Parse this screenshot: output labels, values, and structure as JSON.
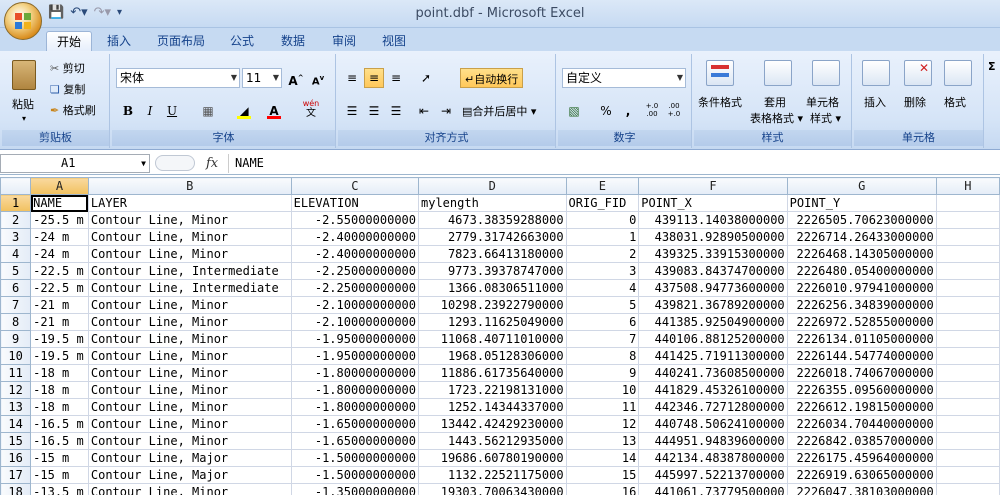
{
  "window": {
    "title": "point.dbf - Microsoft Excel"
  },
  "ribbon": {
    "tabs": [
      "开始",
      "插入",
      "页面布局",
      "公式",
      "数据",
      "审阅",
      "视图"
    ],
    "clipboard": {
      "paste": "粘贴",
      "cut": "剪切",
      "copy": "复制",
      "format_painter": "格式刷",
      "label": "剪贴板"
    },
    "font": {
      "name": "宋体",
      "size": "11",
      "label": "字体",
      "bold": "B",
      "italic": "I",
      "underline": "U",
      "grow": "A",
      "shrink": "A",
      "fill_color": "#ffff00",
      "font_color": "#ff0000",
      "wen": "wén\n文"
    },
    "alignment": {
      "wrap": "自动换行",
      "merge": "合并后居中",
      "label": "对齐方式"
    },
    "number": {
      "format": "自定义",
      "percent": "%",
      "comma": ",",
      "inc": "+.0\n.00",
      "dec": ".00\n+.0",
      "label": "数字"
    },
    "styles": {
      "conditional": "条件格式",
      "table_line1": "套用",
      "table_line2": "表格格式",
      "cell_line1": "单元格",
      "cell_line2": "样式",
      "label": "样式"
    },
    "cells": {
      "insert": "插入",
      "delete": "删除",
      "format": "格式",
      "label": "单元格"
    },
    "editing": {
      "sigma": "Σ"
    }
  },
  "formula_bar": {
    "name_box": "A1",
    "fx": "fx",
    "content": "NAME"
  },
  "sheet": {
    "columns": [
      "A",
      "B",
      "C",
      "D",
      "E",
      "F",
      "G",
      "H"
    ],
    "rows": [
      {
        "n": "1",
        "cells": [
          "NAME",
          "LAYER",
          "ELEVATION",
          "mylength",
          "ORIG_FID",
          "POINT_X",
          "POINT_Y"
        ]
      },
      {
        "n": "2",
        "cells": [
          "-25.5 m",
          "Contour Line, Minor",
          "-2.55000000000",
          "4673.38359288000",
          "0",
          "439113.14038000000",
          "2226505.70623000000"
        ]
      },
      {
        "n": "3",
        "cells": [
          "-24 m",
          "Contour Line, Minor",
          "-2.40000000000",
          "2779.31742663000",
          "1",
          "438031.92890500000",
          "2226714.26433000000"
        ]
      },
      {
        "n": "4",
        "cells": [
          "-24 m",
          "Contour Line, Minor",
          "-2.40000000000",
          "7823.66413180000",
          "2",
          "439325.33915300000",
          "2226468.14305000000"
        ]
      },
      {
        "n": "5",
        "cells": [
          "-22.5 m",
          "Contour Line, Intermediate",
          "-2.25000000000",
          "9773.39378747000",
          "3",
          "439083.84374700000",
          "2226480.05400000000"
        ]
      },
      {
        "n": "6",
        "cells": [
          "-22.5 m",
          "Contour Line, Intermediate",
          "-2.25000000000",
          "1366.08306511000",
          "4",
          "437508.94773600000",
          "2226010.97941000000"
        ]
      },
      {
        "n": "7",
        "cells": [
          "-21 m",
          "Contour Line, Minor",
          "-2.10000000000",
          "10298.23922790000",
          "5",
          "439821.36789200000",
          "2226256.34839000000"
        ]
      },
      {
        "n": "8",
        "cells": [
          "-21 m",
          "Contour Line, Minor",
          "-2.10000000000",
          "1293.11625049000",
          "6",
          "441385.92504900000",
          "2226972.52855000000"
        ]
      },
      {
        "n": "9",
        "cells": [
          "-19.5 m",
          "Contour Line, Minor",
          "-1.95000000000",
          "11068.40711010000",
          "7",
          "440106.88125200000",
          "2226134.01105000000"
        ]
      },
      {
        "n": "10",
        "cells": [
          "-19.5 m",
          "Contour Line, Minor",
          "-1.95000000000",
          "1968.05128306000",
          "8",
          "441425.71911300000",
          "2226144.54774000000"
        ]
      },
      {
        "n": "11",
        "cells": [
          "-18 m",
          "Contour Line, Minor",
          "-1.80000000000",
          "11886.61735640000",
          "9",
          "440241.73608500000",
          "2226018.74067000000"
        ]
      },
      {
        "n": "12",
        "cells": [
          "-18 m",
          "Contour Line, Minor",
          "-1.80000000000",
          "1723.22198131000",
          "10",
          "441829.45326100000",
          "2226355.09560000000"
        ]
      },
      {
        "n": "13",
        "cells": [
          "-18 m",
          "Contour Line, Minor",
          "-1.80000000000",
          "1252.14344337000",
          "11",
          "442346.72712800000",
          "2226612.19815000000"
        ]
      },
      {
        "n": "14",
        "cells": [
          "-16.5 m",
          "Contour Line, Minor",
          "-1.65000000000",
          "13442.42429230000",
          "12",
          "440748.50624100000",
          "2226034.70440000000"
        ]
      },
      {
        "n": "15",
        "cells": [
          "-16.5 m",
          "Contour Line, Minor",
          "-1.65000000000",
          "1443.56212935000",
          "13",
          "444951.94839600000",
          "2226842.03857000000"
        ]
      },
      {
        "n": "16",
        "cells": [
          "-15 m",
          "Contour Line, Major",
          "-1.50000000000",
          "19686.60780190000",
          "14",
          "442134.48387800000",
          "2226175.45964000000"
        ]
      },
      {
        "n": "17",
        "cells": [
          "-15 m",
          "Contour Line, Major",
          "-1.50000000000",
          "1132.22521175000",
          "15",
          "445997.52213700000",
          "2226919.63065000000"
        ]
      },
      {
        "n": "18",
        "cells": [
          "-13.5 m",
          "Contour Line, Minor",
          "-1.35000000000",
          "19303.70063430000",
          "16",
          "441061.73779500000",
          "2226047.38103000000"
        ]
      }
    ]
  }
}
